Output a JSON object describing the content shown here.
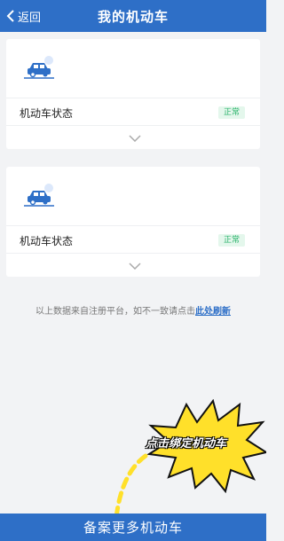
{
  "header": {
    "back_label": "返回",
    "title": "我的机动车"
  },
  "vehicles": [
    {
      "status_label": "机动车状态",
      "status": "正常"
    },
    {
      "status_label": "机动车状态",
      "status": "正常"
    }
  ],
  "notice": {
    "text": "以上数据来自注册平台，如不一致请点击",
    "link": "此处刷新"
  },
  "annotation": {
    "text": "点击绑定机动车"
  },
  "bottom_button": {
    "label": "备案更多机动车"
  },
  "colors": {
    "primary": "#2e6fc7",
    "status_green": "#2bb36b",
    "callout_yellow": "#ffe02a"
  }
}
